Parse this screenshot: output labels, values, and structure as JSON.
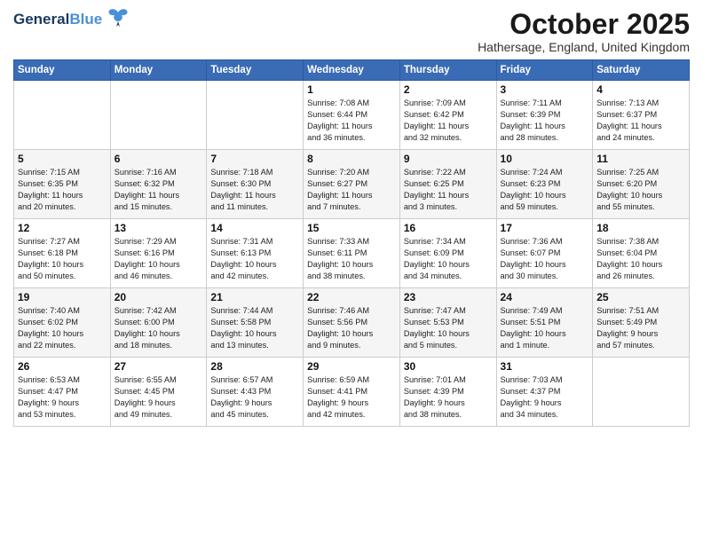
{
  "logo": {
    "general": "General",
    "blue": "Blue"
  },
  "header": {
    "month": "October 2025",
    "location": "Hathersage, England, United Kingdom"
  },
  "weekdays": [
    "Sunday",
    "Monday",
    "Tuesday",
    "Wednesday",
    "Thursday",
    "Friday",
    "Saturday"
  ],
  "weeks": [
    [
      {
        "day": "",
        "info": ""
      },
      {
        "day": "",
        "info": ""
      },
      {
        "day": "",
        "info": ""
      },
      {
        "day": "1",
        "info": "Sunrise: 7:08 AM\nSunset: 6:44 PM\nDaylight: 11 hours\nand 36 minutes."
      },
      {
        "day": "2",
        "info": "Sunrise: 7:09 AM\nSunset: 6:42 PM\nDaylight: 11 hours\nand 32 minutes."
      },
      {
        "day": "3",
        "info": "Sunrise: 7:11 AM\nSunset: 6:39 PM\nDaylight: 11 hours\nand 28 minutes."
      },
      {
        "day": "4",
        "info": "Sunrise: 7:13 AM\nSunset: 6:37 PM\nDaylight: 11 hours\nand 24 minutes."
      }
    ],
    [
      {
        "day": "5",
        "info": "Sunrise: 7:15 AM\nSunset: 6:35 PM\nDaylight: 11 hours\nand 20 minutes."
      },
      {
        "day": "6",
        "info": "Sunrise: 7:16 AM\nSunset: 6:32 PM\nDaylight: 11 hours\nand 15 minutes."
      },
      {
        "day": "7",
        "info": "Sunrise: 7:18 AM\nSunset: 6:30 PM\nDaylight: 11 hours\nand 11 minutes."
      },
      {
        "day": "8",
        "info": "Sunrise: 7:20 AM\nSunset: 6:27 PM\nDaylight: 11 hours\nand 7 minutes."
      },
      {
        "day": "9",
        "info": "Sunrise: 7:22 AM\nSunset: 6:25 PM\nDaylight: 11 hours\nand 3 minutes."
      },
      {
        "day": "10",
        "info": "Sunrise: 7:24 AM\nSunset: 6:23 PM\nDaylight: 10 hours\nand 59 minutes."
      },
      {
        "day": "11",
        "info": "Sunrise: 7:25 AM\nSunset: 6:20 PM\nDaylight: 10 hours\nand 55 minutes."
      }
    ],
    [
      {
        "day": "12",
        "info": "Sunrise: 7:27 AM\nSunset: 6:18 PM\nDaylight: 10 hours\nand 50 minutes."
      },
      {
        "day": "13",
        "info": "Sunrise: 7:29 AM\nSunset: 6:16 PM\nDaylight: 10 hours\nand 46 minutes."
      },
      {
        "day": "14",
        "info": "Sunrise: 7:31 AM\nSunset: 6:13 PM\nDaylight: 10 hours\nand 42 minutes."
      },
      {
        "day": "15",
        "info": "Sunrise: 7:33 AM\nSunset: 6:11 PM\nDaylight: 10 hours\nand 38 minutes."
      },
      {
        "day": "16",
        "info": "Sunrise: 7:34 AM\nSunset: 6:09 PM\nDaylight: 10 hours\nand 34 minutes."
      },
      {
        "day": "17",
        "info": "Sunrise: 7:36 AM\nSunset: 6:07 PM\nDaylight: 10 hours\nand 30 minutes."
      },
      {
        "day": "18",
        "info": "Sunrise: 7:38 AM\nSunset: 6:04 PM\nDaylight: 10 hours\nand 26 minutes."
      }
    ],
    [
      {
        "day": "19",
        "info": "Sunrise: 7:40 AM\nSunset: 6:02 PM\nDaylight: 10 hours\nand 22 minutes."
      },
      {
        "day": "20",
        "info": "Sunrise: 7:42 AM\nSunset: 6:00 PM\nDaylight: 10 hours\nand 18 minutes."
      },
      {
        "day": "21",
        "info": "Sunrise: 7:44 AM\nSunset: 5:58 PM\nDaylight: 10 hours\nand 13 minutes."
      },
      {
        "day": "22",
        "info": "Sunrise: 7:46 AM\nSunset: 5:56 PM\nDaylight: 10 hours\nand 9 minutes."
      },
      {
        "day": "23",
        "info": "Sunrise: 7:47 AM\nSunset: 5:53 PM\nDaylight: 10 hours\nand 5 minutes."
      },
      {
        "day": "24",
        "info": "Sunrise: 7:49 AM\nSunset: 5:51 PM\nDaylight: 10 hours\nand 1 minute."
      },
      {
        "day": "25",
        "info": "Sunrise: 7:51 AM\nSunset: 5:49 PM\nDaylight: 9 hours\nand 57 minutes."
      }
    ],
    [
      {
        "day": "26",
        "info": "Sunrise: 6:53 AM\nSunset: 4:47 PM\nDaylight: 9 hours\nand 53 minutes."
      },
      {
        "day": "27",
        "info": "Sunrise: 6:55 AM\nSunset: 4:45 PM\nDaylight: 9 hours\nand 49 minutes."
      },
      {
        "day": "28",
        "info": "Sunrise: 6:57 AM\nSunset: 4:43 PM\nDaylight: 9 hours\nand 45 minutes."
      },
      {
        "day": "29",
        "info": "Sunrise: 6:59 AM\nSunset: 4:41 PM\nDaylight: 9 hours\nand 42 minutes."
      },
      {
        "day": "30",
        "info": "Sunrise: 7:01 AM\nSunset: 4:39 PM\nDaylight: 9 hours\nand 38 minutes."
      },
      {
        "day": "31",
        "info": "Sunrise: 7:03 AM\nSunset: 4:37 PM\nDaylight: 9 hours\nand 34 minutes."
      },
      {
        "day": "",
        "info": ""
      }
    ]
  ]
}
